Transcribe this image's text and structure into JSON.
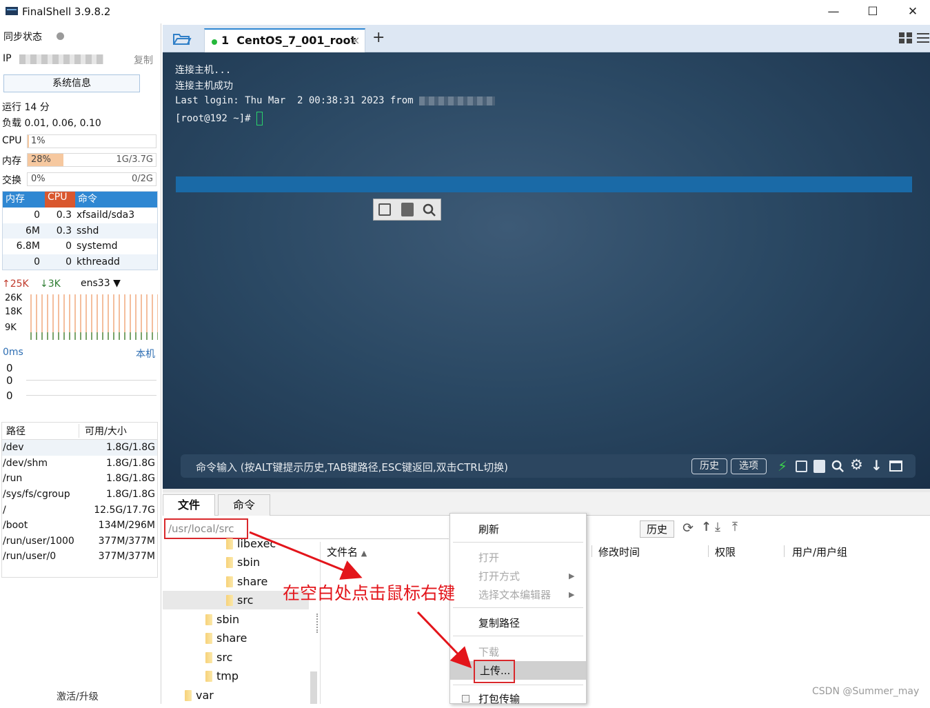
{
  "window": {
    "title": "FinalShell 3.9.8.2",
    "minimize": "—",
    "maximize": "☐",
    "close": "✕"
  },
  "left": {
    "sync_label": "同步状态",
    "ip_label": "IP",
    "copy_label": "复制",
    "sysinfo_button": "系统信息",
    "uptime": "运行 14 分",
    "load": "负载 0.01, 0.06, 0.10",
    "cpu": {
      "label": "CPU",
      "value": "1%",
      "percent": 1
    },
    "mem": {
      "label": "内存",
      "value": "28%",
      "detail": "1G/3.7G",
      "percent": 28
    },
    "swap": {
      "label": "交换",
      "value": "0%",
      "detail": "0/2G",
      "percent": 0
    },
    "proc_headers": [
      "内存",
      "CPU",
      "命令"
    ],
    "processes": [
      {
        "mem": "0",
        "cpu": "0.3",
        "cmd": "xfsaild/sda3"
      },
      {
        "mem": "6M",
        "cpu": "0.3",
        "cmd": "sshd"
      },
      {
        "mem": "6.8M",
        "cpu": "0",
        "cmd": "systemd"
      },
      {
        "mem": "0",
        "cpu": "0",
        "cmd": "kthreadd"
      }
    ],
    "net": {
      "up": "25K",
      "down": "3K",
      "iface": "ens33",
      "y_labels": [
        "26K",
        "18K",
        "9K"
      ]
    },
    "ping": {
      "latency": "0ms",
      "host": "本机",
      "values": [
        "0",
        "0",
        "0"
      ]
    },
    "disk_headers": [
      "路径",
      "可用/大小"
    ],
    "disks": [
      {
        "path": "/dev",
        "size": "1.8G/1.8G"
      },
      {
        "path": "/dev/shm",
        "size": "1.8G/1.8G"
      },
      {
        "path": "/run",
        "size": "1.8G/1.8G"
      },
      {
        "path": "/sys/fs/cgroup",
        "size": "1.8G/1.8G"
      },
      {
        "path": "/",
        "size": "12.5G/17.7G"
      },
      {
        "path": "/boot",
        "size": "134M/296M"
      },
      {
        "path": "/run/user/1000",
        "size": "377M/377M"
      },
      {
        "path": "/run/user/0",
        "size": "377M/377M"
      }
    ],
    "upgrade": "激活/升级"
  },
  "tab": {
    "label": "1  CentOS_7_001_root",
    "close": "×",
    "add": "+"
  },
  "terminal": {
    "lines": [
      "连接主机...",
      "连接主机成功",
      "Last login: Thu Mar  2 00:38:31 2023 from",
      "[root@192 ~]# "
    ],
    "cmd_placeholder": "命令输入 (按ALT键提示历史,TAB键路径,ESC键返回,双击CTRL切换)",
    "history_button": "历史",
    "options_button": "选项"
  },
  "files": {
    "tab_files": "文件",
    "tab_commands": "命令",
    "path": "/usr/local/src",
    "history_button": "历史",
    "tree": [
      "libexec",
      "sbin",
      "share",
      "src",
      "sbin",
      "share",
      "src",
      "tmp",
      "var"
    ],
    "columns": [
      "文件名",
      "修改时间",
      "权限",
      "用户/用户组"
    ]
  },
  "context_menu": {
    "refresh": "刷新",
    "open": "打开",
    "open_with": "打开方式",
    "choose_editor": "选择文本编辑器",
    "copy_path": "复制路径",
    "download": "下载",
    "upload": "上传...",
    "pack_transfer": "打包传输"
  },
  "annotation": "在空白处点击鼠标右键",
  "watermark": "CSDN @Summer_may",
  "colors": {
    "accent": "#2f87d2",
    "annotation": "#e3151b",
    "terminal_bg": "#2a4863"
  }
}
